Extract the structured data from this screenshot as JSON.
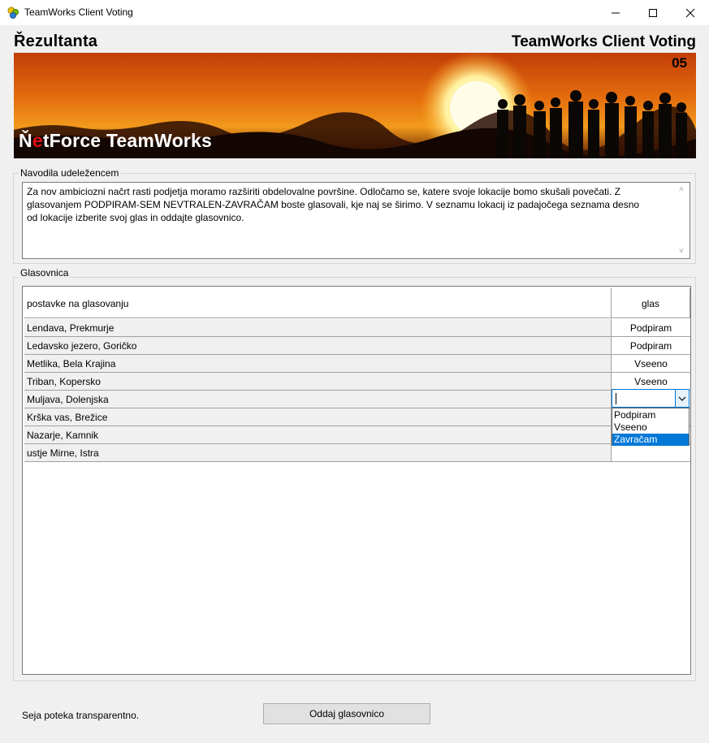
{
  "window": {
    "title": "TeamWorks Client Voting"
  },
  "header": {
    "logo_left": "Řezultanta",
    "logo_right": "TeamWorks Client Voting",
    "version": "05",
    "brand_n": "Ň",
    "brand_e": "e",
    "brand_rest": "tForce TeamWorks"
  },
  "instructions": {
    "group_title": "Navodila udeležencem",
    "text": "Za nov ambiciozni načrt rasti podjetja moramo razširiti obdelovalne površine. Odločamo se, katere svoje lokacije bomo skušali povečati. Z glasovanjem PODPIRAM-SEM NEVTRALEN-ZAVRAČAM boste glasovali, kje naj se širimo. V seznamu lokacij iz padajočega seznama desno od lokacije izberite svoj glas in oddajte glasovnico."
  },
  "ballot": {
    "group_title": "Glasovnica",
    "columns": [
      "postavke na glasovanju",
      "glas"
    ],
    "rows": [
      {
        "item": "Lendava, Prekmurje",
        "vote": "Podpiram"
      },
      {
        "item": "Ledavsko jezero, Goričko",
        "vote": "Podpiram"
      },
      {
        "item": "Metlika, Bela Krajina",
        "vote": "Vseeno"
      },
      {
        "item": "Triban, Kopersko",
        "vote": "Vseeno"
      },
      {
        "item": "Muljava, Dolenjska",
        "vote": ""
      },
      {
        "item": "Krška vas, Brežice",
        "vote": ""
      },
      {
        "item": "Nazarje, Kamnik",
        "vote": ""
      },
      {
        "item": "ustje Mirne, Istra",
        "vote": ""
      }
    ],
    "dropdown_options": [
      "Podpiram",
      "Vseeno",
      "Zavračam"
    ],
    "dropdown_highlighted": "Zavračam"
  },
  "footer": {
    "status": "Seja poteka transparentno.",
    "submit_label": "Oddaj glasovnico"
  },
  "colors": {
    "selection": "#0078d7",
    "brand_accent": "#e01010"
  },
  "icons": [
    "app-icon",
    "minimize-icon",
    "maximize-icon",
    "close-icon",
    "chevron-down-icon",
    "scroll-up-icon",
    "scroll-down-icon"
  ]
}
